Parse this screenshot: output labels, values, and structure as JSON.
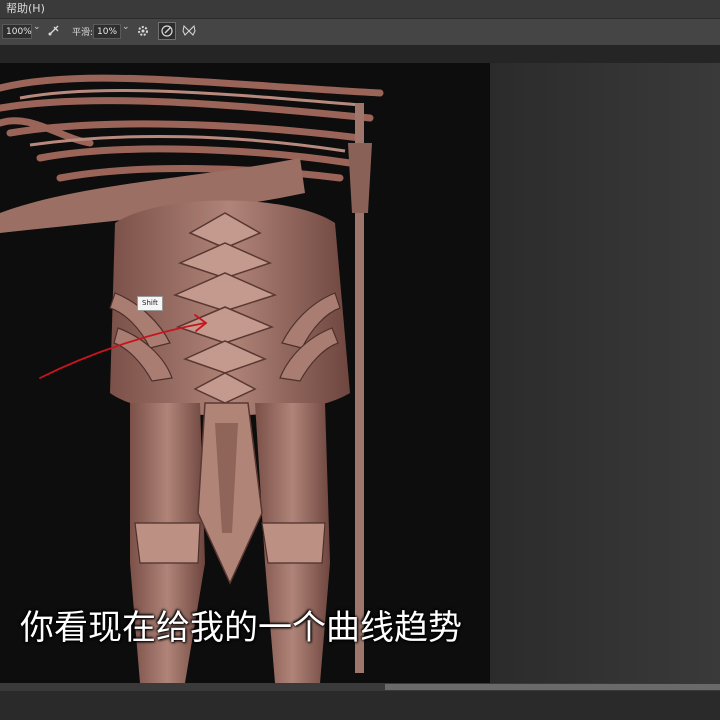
{
  "menubar": {
    "help_label": "帮助(H)"
  },
  "options": {
    "size_value": "100%",
    "smoothing_label": "平滑:",
    "smoothing_value": "10%"
  },
  "canvas": {
    "tooltip_text": "Shift",
    "subtitle": "你看现在给我的一个曲线趋势"
  },
  "colors": {
    "annotation_stroke": "#c8141e",
    "sculpt_base": "#a07468"
  },
  "icons": [
    "airbrush-icon",
    "gear-icon",
    "pressure-icon",
    "butterfly-icon",
    "chevron-down-icon"
  ]
}
